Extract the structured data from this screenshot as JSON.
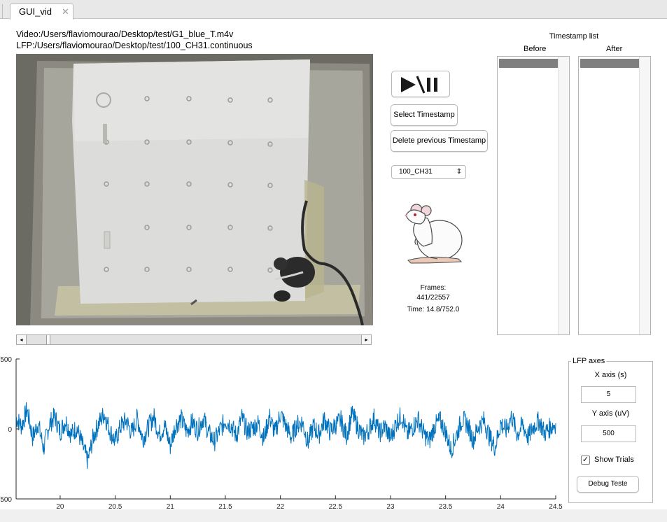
{
  "window": {
    "tab_title": "GUI_vid",
    "tab_close": "✕"
  },
  "paths": {
    "video": "Video:/Users/flaviomourao/Desktop/test/G1_blue_T.m4v",
    "lfp": "LFP:/Users/flaviomourao/Desktop/test/100_CH31.continuous"
  },
  "player": {
    "play_pause_icon": "play-pause-icon",
    "select_timestamp": "Select Timestamp",
    "delete_timestamp": "Delete previous Timestamp",
    "channel_selected": "100_CH31",
    "channel_caret": "⌃⌄",
    "frames_label": "Frames:",
    "frames_value": "441/22557",
    "time_text": "Time: 14.8/752.0",
    "scroll_position": 0.06,
    "scroll_left": "◂",
    "scroll_right": "▸"
  },
  "timestamps": {
    "title": "Timestamp list",
    "before_label": "Before",
    "after_label": "After",
    "before_items": [],
    "after_items": []
  },
  "lfp_panel": {
    "title": "LFP axes",
    "x_axis_label": "X axis (s)",
    "x_axis_value": "5",
    "y_axis_label": "Y axis (uV)",
    "y_axis_value": "500",
    "show_trials_label": "Show Trials",
    "show_trials_checked": true,
    "debug_button": "Debug Teste"
  },
  "colors": {
    "trace": "#0072BD",
    "list_selection": "#7f7f7f"
  },
  "chart_data": {
    "type": "line",
    "x_range": [
      19.6,
      24.5
    ],
    "y_range": [
      -500,
      500
    ],
    "x_ticks": [
      20,
      20.5,
      21,
      21.5,
      22,
      22.5,
      23,
      23.5,
      24,
      24.5
    ],
    "x_tick_labels": [
      "20",
      "20.5",
      "21",
      "21.5",
      "22",
      "22.5",
      "23",
      "23.5",
      "24",
      "24.5"
    ],
    "y_ticks": [
      -500,
      0,
      500
    ],
    "y_tick_labels": [
      "500",
      "0",
      "500"
    ],
    "grid": false,
    "series": [
      {
        "color": "#0072BD",
        "x": [
          19.6,
          19.65,
          19.7,
          19.75,
          19.8,
          19.85,
          19.9,
          19.95,
          20,
          20.05,
          20.1,
          20.15,
          20.2,
          20.25,
          20.3,
          20.35,
          20.4,
          20.45,
          20.5,
          20.55,
          20.6,
          20.65,
          20.7,
          20.75,
          20.8,
          20.85,
          20.9,
          20.95,
          21,
          21.05,
          21.1,
          21.15,
          21.2,
          21.25,
          21.3,
          21.35,
          21.4,
          21.45,
          21.5,
          21.55,
          21.6,
          21.65,
          21.7,
          21.75,
          21.8,
          21.85,
          21.9,
          21.95,
          22,
          22.05,
          22.1,
          22.15,
          22.2,
          22.25,
          22.3,
          22.35,
          22.4,
          22.45,
          22.5,
          22.55,
          22.6,
          22.65,
          22.7,
          22.75,
          22.8,
          22.85,
          22.9,
          22.95,
          23,
          23.05,
          23.1,
          23.15,
          23.2,
          23.25,
          23.3,
          23.35,
          23.4,
          23.45,
          23.5,
          23.55,
          23.6,
          23.65,
          23.7,
          23.75,
          23.8,
          23.85,
          23.9,
          23.95,
          24,
          24.05,
          24.1,
          24.15,
          24.2,
          24.25,
          24.3,
          24.35,
          24.4,
          24.45,
          24.5
        ],
        "y": [
          80,
          20,
          140,
          -60,
          40,
          -140,
          30,
          90,
          -20,
          60,
          -40,
          10,
          -110,
          -230,
          -60,
          40,
          110,
          -10,
          -90,
          20,
          60,
          -30,
          80,
          -70,
          10,
          90,
          -40,
          20,
          -120,
          30,
          70,
          -20,
          50,
          -10,
          80,
          -30,
          -90,
          -10,
          60,
          30,
          -50,
          80,
          -20,
          10,
          40,
          -70,
          90,
          -30,
          110,
          20,
          -60,
          30,
          50,
          -100,
          20,
          -40,
          70,
          -20,
          30,
          60,
          -50,
          110,
          20,
          -60,
          -10,
          80,
          -30,
          20,
          -70,
          40,
          100,
          -40,
          10,
          70,
          -30,
          -90,
          20,
          60,
          -20,
          -150,
          -40,
          70,
          30,
          -80,
          20,
          60,
          -60,
          -130,
          40,
          -10,
          90,
          -40,
          30,
          -60,
          20,
          60,
          -30,
          10,
          40
        ]
      }
    ]
  }
}
